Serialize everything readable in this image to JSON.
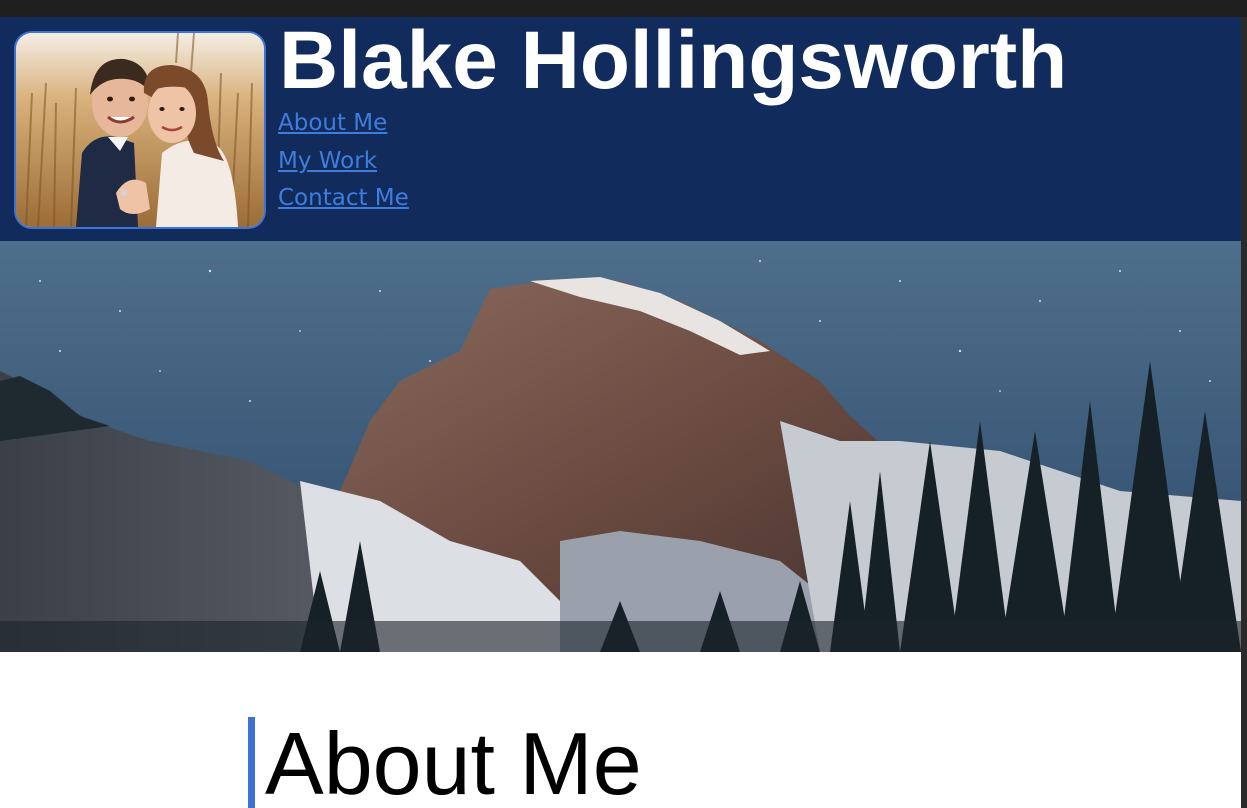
{
  "header": {
    "title": "Blake Hollingsworth",
    "background_color": "#112b5c",
    "photo": {
      "subject": "portrait-couple-photo"
    }
  },
  "nav": {
    "link_color": "#3f7ddc",
    "items": [
      {
        "label": "About Me"
      },
      {
        "label": "My Work"
      },
      {
        "label": "Contact Me"
      }
    ]
  },
  "hero": {
    "subject": "mountain-night-sky-image"
  },
  "about": {
    "heading": "About Me",
    "accent_color": "#3d74d3"
  }
}
